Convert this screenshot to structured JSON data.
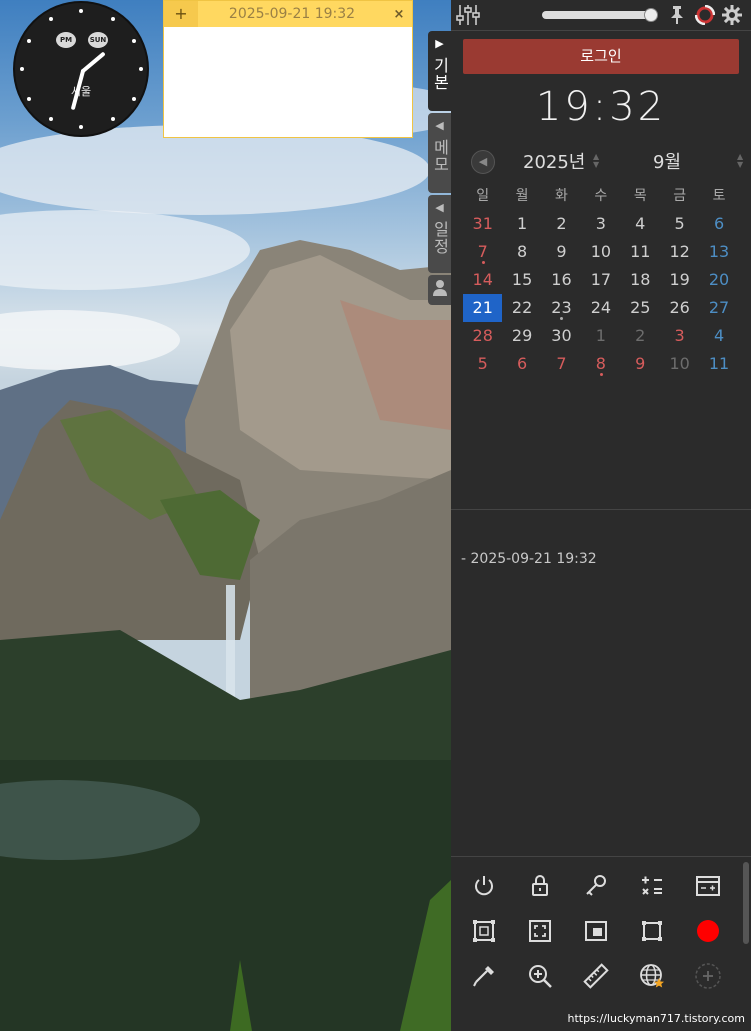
{
  "clock": {
    "ampm": "PM",
    "weekday": "SUN",
    "city": "서울"
  },
  "memo": {
    "add_label": "+",
    "date": "2025-09-21 19:32",
    "close_label": "×"
  },
  "side_tabs": [
    {
      "arrow": "▶",
      "label": "기본"
    },
    {
      "arrow": "◀",
      "label": "메모"
    },
    {
      "arrow": "◀",
      "label": "일정"
    }
  ],
  "panel": {
    "login_label": "로그인",
    "time": "19:32",
    "year_label": "2025년",
    "month_label": "9월",
    "prev_label": "◀",
    "weekdays": [
      "일",
      "월",
      "화",
      "수",
      "목",
      "금",
      "토"
    ],
    "weeks": [
      [
        "31",
        "1",
        "2",
        "3",
        "4",
        "5",
        "6"
      ],
      [
        "7",
        "8",
        "9",
        "10",
        "11",
        "12",
        "13"
      ],
      [
        "14",
        "15",
        "16",
        "17",
        "18",
        "19",
        "20"
      ],
      [
        "21",
        "22",
        "23",
        "24",
        "25",
        "26",
        "27"
      ],
      [
        "28",
        "29",
        "30",
        "1",
        "2",
        "3",
        "4"
      ],
      [
        "5",
        "6",
        "7",
        "8",
        "9",
        "10",
        "11"
      ]
    ],
    "memo_entry": "- 2025-09-21 19:32"
  },
  "toolbar": {
    "record_color": "#ff0000",
    "rows": [
      [
        "power-icon",
        "lock-icon",
        "key-icon",
        "calculator-icon",
        "calendar-card-icon"
      ],
      [
        "capture-region-icon",
        "capture-fullscreen-icon",
        "capture-window-icon",
        "capture-rect-icon",
        "record-icon"
      ],
      [
        "color-picker-icon",
        "zoom-in-icon",
        "ruler-icon",
        "globe-star-icon",
        "add-icon"
      ]
    ]
  },
  "footer": {
    "url": "https://luckyman717.tistory.com"
  },
  "colors": {
    "panel_bg": "#2b2b2b",
    "login_bg": "#9a3a32",
    "today_bg": "#1f64c8",
    "sunday": "#d65c5c",
    "saturday": "#4d8ec4",
    "memo_header": "#ffd860"
  }
}
